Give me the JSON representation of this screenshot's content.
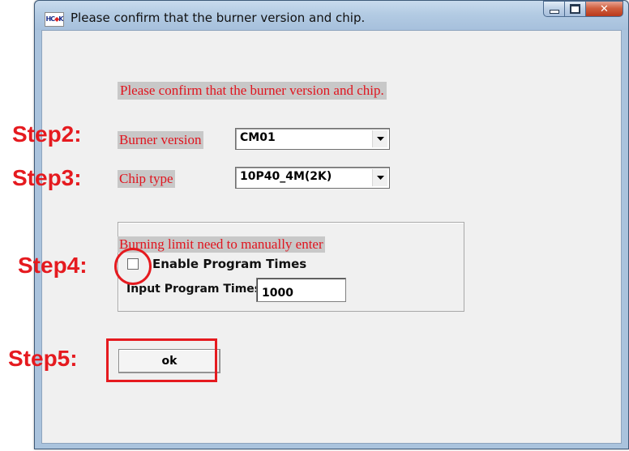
{
  "window": {
    "title": "Please confirm that the burner version and chip.",
    "icon_text_blue_1": "HC",
    "icon_text_red": "◆",
    "icon_text_blue_2": "K"
  },
  "dialog": {
    "message": "Please confirm that the burner version and chip.",
    "burner_label": "Burner version",
    "burner_value": "CM01",
    "chip_label": "Chip type",
    "chip_value": "10P40_4M(2K)",
    "group_title": "Burning limit need to manually enter",
    "enable_label": "Enable Program Times",
    "enable_checked": false,
    "input_label": "Input Program Times",
    "input_value": "1000",
    "ok_label": "ok"
  },
  "annotations": {
    "step2": "Step2:",
    "step3": "Step3:",
    "step4": "Step4:",
    "step5": "Step5:",
    "color": "#e51a1f"
  }
}
